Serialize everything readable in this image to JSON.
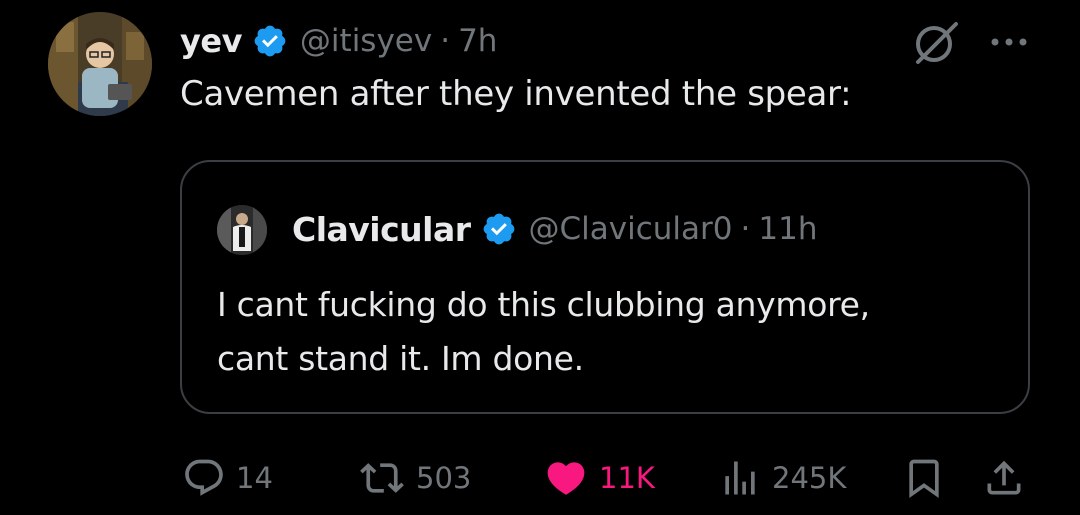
{
  "tweet": {
    "author": {
      "name": "yev",
      "handle": "@itisyev",
      "time": "7h",
      "separator": "·"
    },
    "text": "Cavemen after they invented the spear:",
    "top_icons": [
      "grok-icon",
      "more-icon"
    ]
  },
  "quoted_tweet": {
    "author": {
      "name": "Clavicular",
      "handle": "@Clavicular0",
      "time": "11h",
      "separator": "·"
    },
    "text": "I cant fucking do this clubbing anymore,\ncant stand it. Im done."
  },
  "actions": {
    "reply": {
      "icon": "reply-icon",
      "count": "14"
    },
    "repost": {
      "icon": "repost-icon",
      "count": "503"
    },
    "like": {
      "icon": "heart-icon",
      "count": "11K",
      "liked": true
    },
    "views": {
      "icon": "views-icon",
      "count": "245K"
    },
    "bookmark": {
      "icon": "bookmark-icon"
    },
    "share": {
      "icon": "share-icon"
    }
  },
  "colors": {
    "background": "#000000",
    "text_primary": "#e7e9ea",
    "text_secondary": "#71767b",
    "verified_blue": "#1d9bf0",
    "like_pink": "#f91880",
    "border": "#3b3e42"
  }
}
